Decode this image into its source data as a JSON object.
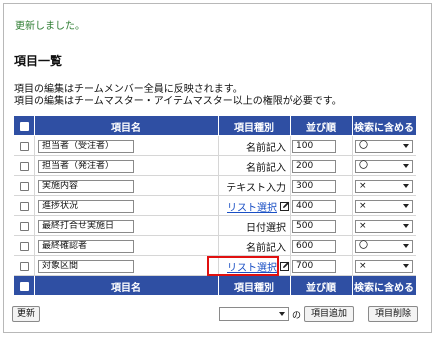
{
  "message": "更新しました。",
  "title": "項目一覧",
  "description": [
    "項目の編集はチームメンバー全員に反映されます。",
    "項目の編集はチームマスター・アイテムマスター以上の権限が必要です。"
  ],
  "headers": {
    "name": "項目名",
    "kind": "項目種別",
    "order": "並び順",
    "search": "検索に含める"
  },
  "rows": [
    {
      "name": "担当者（受注者）",
      "kind": "名前記入",
      "link": false,
      "order": "100",
      "search": "〇"
    },
    {
      "name": "担当者（発注者）",
      "kind": "名前記入",
      "link": false,
      "order": "200",
      "search": "〇"
    },
    {
      "name": "実施内容",
      "kind": "テキスト入力",
      "link": false,
      "order": "300",
      "search": "×"
    },
    {
      "name": "進捗状況",
      "kind": "リスト選択",
      "link": true,
      "order": "400",
      "search": "×"
    },
    {
      "name": "最終打合せ実施日",
      "kind": "日付選択",
      "link": false,
      "order": "500",
      "search": "×"
    },
    {
      "name": "最終確認者",
      "kind": "名前記入",
      "link": false,
      "order": "600",
      "search": "〇"
    },
    {
      "name": "対象区間",
      "kind": "リスト選択",
      "link": true,
      "order": "700",
      "search": "×",
      "highlighted": true
    }
  ],
  "buttons": {
    "update": "更新",
    "bulk_select": "",
    "no_label": "の",
    "add_item": "項目追加",
    "delete_item": "項目削除"
  },
  "colors": {
    "header_bg": "#2f4fa3",
    "message": "#2e7d32",
    "link": "#1a4fc4",
    "highlight": "#e01010"
  },
  "icons": {
    "edit": "edit-pencil-icon",
    "dropdown": "chevron-down-icon"
  }
}
